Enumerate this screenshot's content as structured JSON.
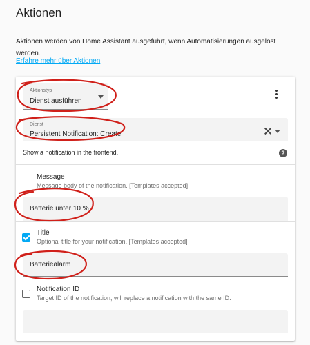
{
  "page": {
    "title": "Aktionen",
    "intro": "Aktionen werden von Home Assistant ausgeführt, wenn Automatisierungen ausgelöst werden.",
    "learn_more": "Erfahre mehr über Aktionen"
  },
  "action": {
    "type_label": "Aktionstyp",
    "type_value": "Dienst ausführen",
    "service_label": "Dienst",
    "service_value": "Persistent Notification: Create",
    "description": "Show a notification in the frontend."
  },
  "params": {
    "message": {
      "title": "Message",
      "desc": "Message body of the notification. [Templates accepted]",
      "value": "Batterie unter 10 %"
    },
    "title_param": {
      "title": "Title",
      "desc": "Optional title for your notification. [Templates accepted]",
      "value": "Batteriealarm",
      "checked": true
    },
    "notification_id": {
      "title": "Notification ID",
      "desc": "Target ID of the notification, will replace a notification with the same ID.",
      "value": "",
      "checked": false
    }
  },
  "icons": {
    "menu": "more-vert-icon",
    "clear": "close-icon",
    "dropdown": "chevron-down-icon",
    "help": "help-circle-icon",
    "checkbox": "checkbox-icon"
  },
  "colors": {
    "accent": "#03a9f4",
    "annotation": "#d0201a"
  }
}
